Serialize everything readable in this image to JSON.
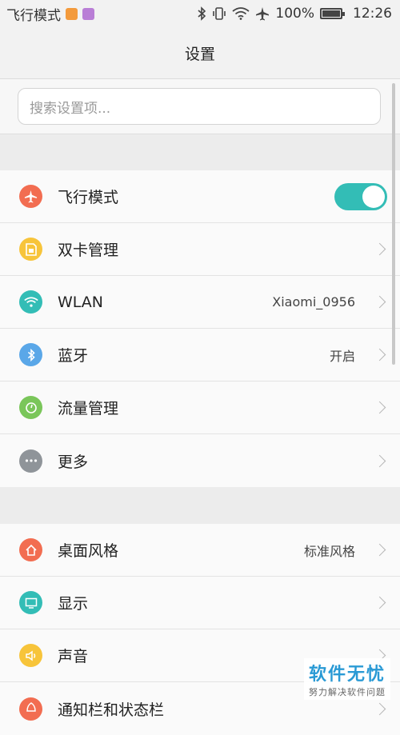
{
  "status_bar": {
    "mode_text": "飞行模式",
    "battery_percent": "100%",
    "time": "12:26"
  },
  "title": "设置",
  "search": {
    "placeholder": "搜索设置项..."
  },
  "section1": [
    {
      "label": "飞行模式",
      "icon": "airplane-icon",
      "color": "#f26d51",
      "toggle_on": true
    },
    {
      "label": "双卡管理",
      "icon": "sim-card-icon",
      "color": "#f7c43a"
    },
    {
      "label": "WLAN",
      "icon": "wifi-icon",
      "color": "#33bdb6",
      "value": "Xiaomi_0956"
    },
    {
      "label": "蓝牙",
      "icon": "bluetooth-icon",
      "color": "#5aa7e8",
      "value": "开启"
    },
    {
      "label": "流量管理",
      "icon": "data-usage-icon",
      "color": "#7ac65a"
    },
    {
      "label": "更多",
      "icon": "more-icon",
      "color": "#8f9499"
    }
  ],
  "section2": [
    {
      "label": "桌面风格",
      "icon": "home-icon",
      "color": "#f26d51",
      "value": "标准风格"
    },
    {
      "label": "显示",
      "icon": "display-icon",
      "color": "#33bdb6"
    },
    {
      "label": "声音",
      "icon": "speaker-icon",
      "color": "#f7c43a"
    },
    {
      "label": "通知栏和状态栏",
      "icon": "notification-icon",
      "color": "#f26d51"
    }
  ],
  "watermark": {
    "title": "软件无忧",
    "subtitle": "努力解决软件问题"
  }
}
